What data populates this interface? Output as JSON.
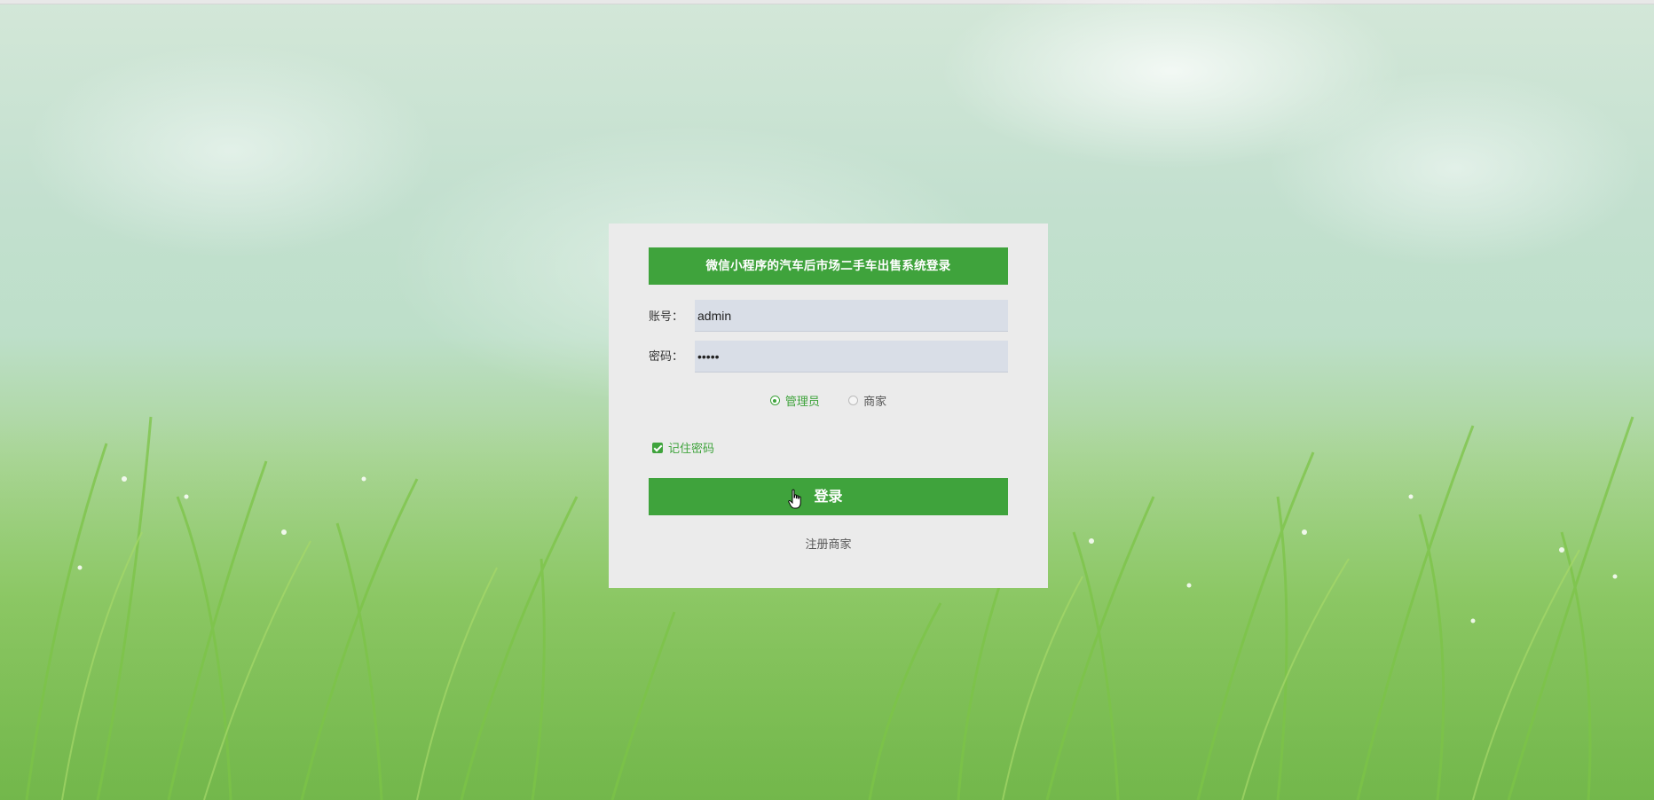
{
  "login": {
    "title": "微信小程序的汽车后市场二手车出售系统登录",
    "account_label": "账号：",
    "account_value": "admin",
    "password_label": "密码：",
    "password_value": "•••••",
    "roles": [
      {
        "label": "管理员",
        "selected": true
      },
      {
        "label": "商家",
        "selected": false
      }
    ],
    "remember_label": "记住密码",
    "submit_label": "登录",
    "register_label": "注册商家"
  },
  "colors": {
    "accent": "#3fa33c",
    "card_background": "#ebebeb",
    "input_background": "#d9dee7"
  }
}
